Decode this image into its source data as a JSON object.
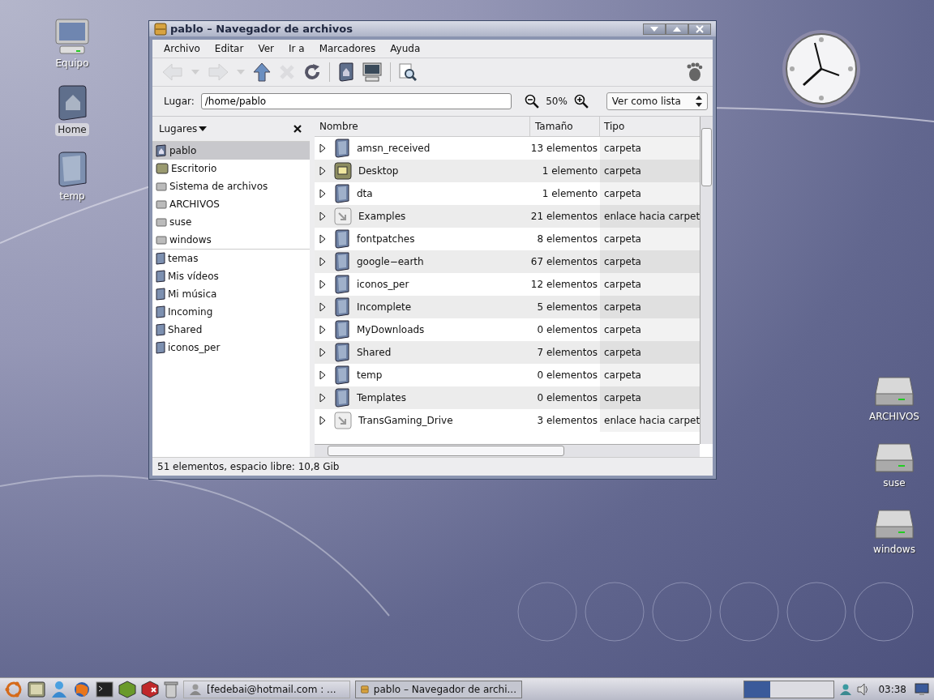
{
  "desktop_icons_left": [
    {
      "label": "Equipo",
      "kind": "computer",
      "selected": false
    },
    {
      "label": "Home",
      "kind": "home",
      "selected": true
    },
    {
      "label": "temp",
      "kind": "folder",
      "selected": false
    }
  ],
  "desktop_icons_right": [
    {
      "label": "ARCHIVOS",
      "kind": "drive"
    },
    {
      "label": "suse",
      "kind": "drive"
    },
    {
      "label": "windows",
      "kind": "drive"
    }
  ],
  "window": {
    "title": "pablo – Navegador de archivos",
    "menu": [
      "Archivo",
      "Editar",
      "Ver",
      "Ir a",
      "Marcadores",
      "Ayuda"
    ],
    "toolbar": [
      {
        "kind": "back",
        "disabled": true
      },
      {
        "kind": "dropdown",
        "disabled": true
      },
      {
        "kind": "forward",
        "disabled": true
      },
      {
        "kind": "dropdown",
        "disabled": true
      },
      {
        "kind": "up",
        "disabled": false
      },
      {
        "kind": "stop",
        "disabled": true
      },
      {
        "kind": "reload",
        "disabled": false
      },
      {
        "kind": "separator"
      },
      {
        "kind": "home",
        "disabled": false
      },
      {
        "kind": "computer",
        "disabled": false
      },
      {
        "kind": "separator"
      },
      {
        "kind": "search",
        "disabled": false
      }
    ],
    "location": {
      "label": "Lugar:",
      "value": "/home/pablo"
    },
    "zoom": "50%",
    "view_mode": "Ver como lista",
    "sidebar": {
      "title": "Lugares",
      "groups": [
        [
          {
            "label": "pablo",
            "kind": "home",
            "selected": true
          },
          {
            "label": "Escritorio",
            "kind": "desktop",
            "selected": false
          },
          {
            "label": "Sistema de archivos",
            "kind": "drive",
            "selected": false
          },
          {
            "label": "ARCHIVOS",
            "kind": "drive",
            "selected": false
          },
          {
            "label": "suse",
            "kind": "drive",
            "selected": false
          },
          {
            "label": "windows",
            "kind": "drive",
            "selected": false
          }
        ],
        [
          {
            "label": "temas",
            "kind": "folder",
            "selected": false
          },
          {
            "label": "Mis vídeos",
            "kind": "folder",
            "selected": false
          },
          {
            "label": "Mi música",
            "kind": "folder",
            "selected": false
          },
          {
            "label": "Incoming",
            "kind": "folder",
            "selected": false
          },
          {
            "label": "Shared",
            "kind": "folder",
            "selected": false
          },
          {
            "label": "iconos_per",
            "kind": "folder",
            "selected": false
          }
        ]
      ]
    },
    "table": {
      "columns": [
        "Nombre",
        "Tamaño",
        "Tipo"
      ],
      "rows": [
        {
          "name": "amsn_received",
          "size": "13 elementos",
          "type": "carpeta",
          "kind": "folder"
        },
        {
          "name": "Desktop",
          "size": "1 elemento",
          "type": "carpeta",
          "kind": "desktop"
        },
        {
          "name": "dta",
          "size": "1 elemento",
          "type": "carpeta",
          "kind": "folder"
        },
        {
          "name": "Examples",
          "size": "21 elementos",
          "type": "enlace hacia carpet",
          "kind": "link"
        },
        {
          "name": "fontpatches",
          "size": "8 elementos",
          "type": "carpeta",
          "kind": "folder"
        },
        {
          "name": "google−earth",
          "size": "67 elementos",
          "type": "carpeta",
          "kind": "folder"
        },
        {
          "name": "iconos_per",
          "size": "12 elementos",
          "type": "carpeta",
          "kind": "folder"
        },
        {
          "name": "Incomplete",
          "size": "5 elementos",
          "type": "carpeta",
          "kind": "folder"
        },
        {
          "name": "MyDownloads",
          "size": "0 elementos",
          "type": "carpeta",
          "kind": "folder"
        },
        {
          "name": "Shared",
          "size": "7 elementos",
          "type": "carpeta",
          "kind": "folder"
        },
        {
          "name": "temp",
          "size": "0 elementos",
          "type": "carpeta",
          "kind": "folder"
        },
        {
          "name": "Templates",
          "size": "0 elementos",
          "type": "carpeta",
          "kind": "folder"
        },
        {
          "name": "TransGaming_Drive",
          "size": "3 elementos",
          "type": "enlace hacia carpet",
          "kind": "link"
        }
      ]
    },
    "status_bar": "51 elementos, espacio libre: 10,8 Gib"
  },
  "taskbar": {
    "launchers": [
      {
        "kind": "menu"
      },
      {
        "kind": "desktop"
      },
      {
        "kind": "messenger"
      },
      {
        "kind": "browser"
      },
      {
        "kind": "terminal"
      },
      {
        "kind": "package"
      },
      {
        "kind": "package-remove"
      },
      {
        "kind": "trash"
      }
    ],
    "tasks": [
      {
        "label": "[fedebai@hotmail.com : ...",
        "kind": "messenger",
        "selected": false
      },
      {
        "label": "pablo – Navegador de archi...",
        "kind": "files",
        "selected": true
      }
    ],
    "clock": "03:38"
  }
}
